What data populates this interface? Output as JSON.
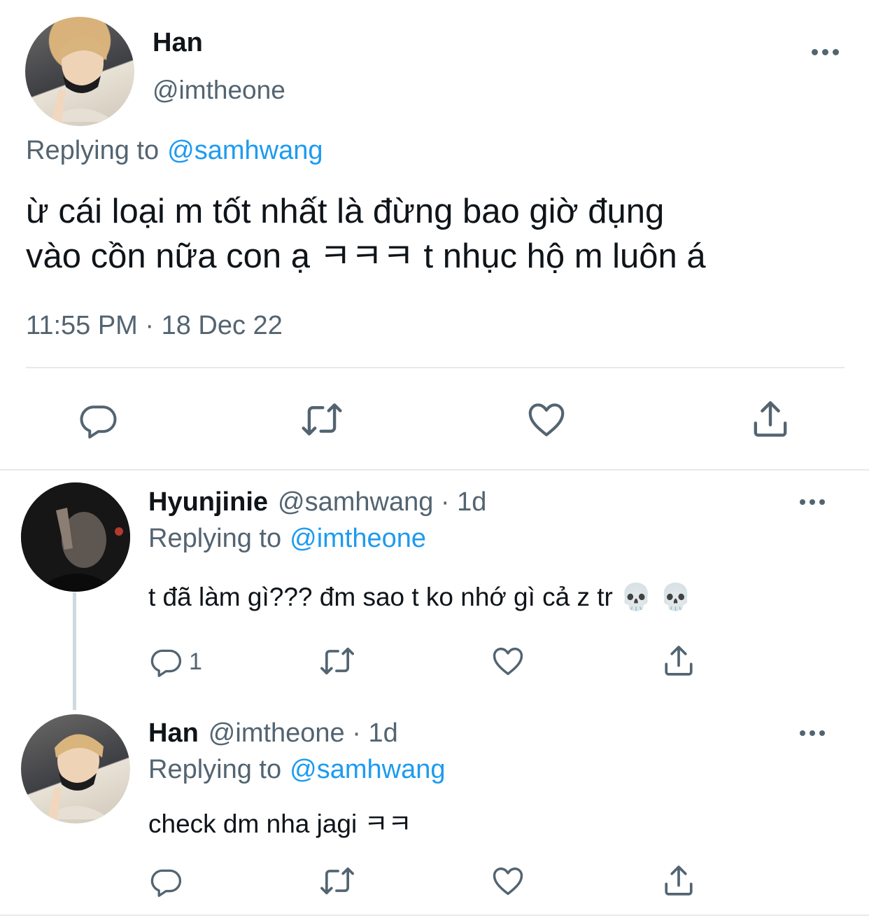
{
  "main_tweet": {
    "author_name": "Han",
    "author_handle": "@imtheone",
    "replying_to_label": "Replying to",
    "replying_to_handle": "@samhwang",
    "text_line1": "ừ cái loại m tốt nhất là đừng bao giờ đụng",
    "text_line2": "vào cồn nữa con ạ ㅋㅋㅋ t nhục hộ m luôn á",
    "timestamp": "11:55 PM · 18 Dec 22"
  },
  "replies": [
    {
      "author_name": "Hyunjinie",
      "author_handle": "@samhwang",
      "separator": " · ",
      "age": "1d",
      "replying_to_label": "Replying to",
      "replying_to_handle": "@imtheone",
      "text": "t đã làm gì??? đm sao t ko nhớ gì cả z tr 💀 💀",
      "reply_count": "1"
    },
    {
      "author_name": "Han",
      "author_handle": "@imtheone",
      "separator": " · ",
      "age": "1d",
      "replying_to_label": "Replying to",
      "replying_to_handle": "@samhwang",
      "text": "check dm nha jagi ㅋㅋ",
      "reply_count": ""
    }
  ],
  "icons": {
    "reply": "reply-icon",
    "retweet": "retweet-icon",
    "like": "heart-icon",
    "share": "share-icon",
    "more": "more-icon"
  },
  "colors": {
    "text": "#0f1419",
    "muted": "#536471",
    "link": "#1d9bf0",
    "divider": "#e7e9ea"
  }
}
